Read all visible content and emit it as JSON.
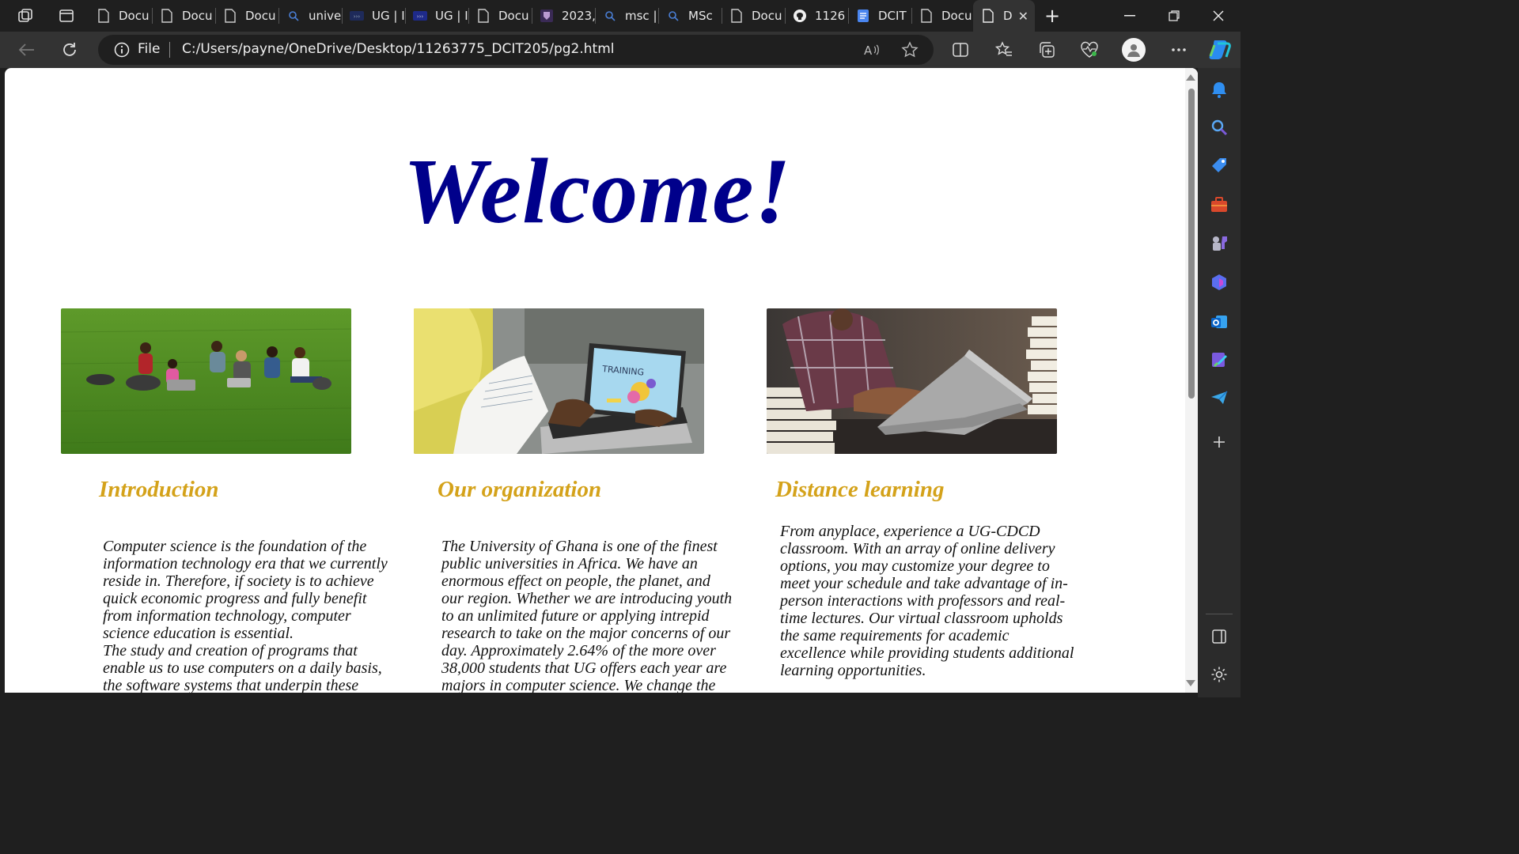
{
  "browser": {
    "tabs": [
      {
        "label": "Docu",
        "icon": "document-icon"
      },
      {
        "label": "Docu",
        "icon": "document-icon"
      },
      {
        "label": "Docu",
        "icon": "document-icon"
      },
      {
        "label": "unive",
        "icon": "search-icon"
      },
      {
        "label": "UG | I",
        "icon": "ug-logo-icon"
      },
      {
        "label": "UG | I",
        "icon": "ug-logo-icon"
      },
      {
        "label": "Docu",
        "icon": "document-icon"
      },
      {
        "label": "2023,",
        "icon": "crest-icon"
      },
      {
        "label": "msc |",
        "icon": "search-icon"
      },
      {
        "label": "MSc",
        "icon": "search-icon"
      },
      {
        "label": "Docu",
        "icon": "document-icon"
      },
      {
        "label": "1126",
        "icon": "github-icon"
      },
      {
        "label": "DCIT",
        "icon": "google-docs-icon"
      },
      {
        "label": "Docu",
        "icon": "document-icon"
      },
      {
        "label": "D",
        "icon": "document-icon"
      }
    ],
    "address": {
      "scheme_label": "File",
      "url": "C:/Users/payne/OneDrive/Desktop/11263775_DCIT205/pg2.html"
    }
  },
  "page": {
    "heading": "Welcome!",
    "cards": [
      {
        "image": "students-on-grass-photo",
        "title": "Introduction",
        "paragraphs": [
          "Computer science is the foundation of the information technology era that we currently reside in. Therefore, if society is to achieve quick economic progress and fully benefit from information technology, computer science education is essential.",
          "The study and creation of programs that enable us to use computers on a daily basis, the software systems that underpin these"
        ]
      },
      {
        "image": "student-laptop-training-photo",
        "title": "Our organization",
        "paragraphs": [
          "The University of Ghana is one of the finest public universities in Africa. We have an enormous effect on people, the planet, and our region. Whether we are introducing youth to an unlimited future or applying intrepid research to take on the major concerns of our day. Approximately 2.64% of the more over 38,000 students that UG offers each year are majors in computer science. We change the"
        ],
        "laptop_screen_text": "TRAINING"
      },
      {
        "image": "man-typing-laptop-photo",
        "title": "Distance learning",
        "paragraphs": [
          "From anyplace, experience a UG-CDCD classroom. With an array of online delivery options, you may customize your degree to meet your schedule and take advantage of in-person interactions with professors and real-time lectures. Our virtual classroom upholds the same requirements for academic excellence while providing students additional learning opportunities."
        ]
      }
    ]
  },
  "colors": {
    "heading": "#00008b",
    "card_title": "#d4a21a",
    "body_text": "#111111",
    "chrome_dark": "#1f1f1f",
    "toolbar": "#333333"
  }
}
